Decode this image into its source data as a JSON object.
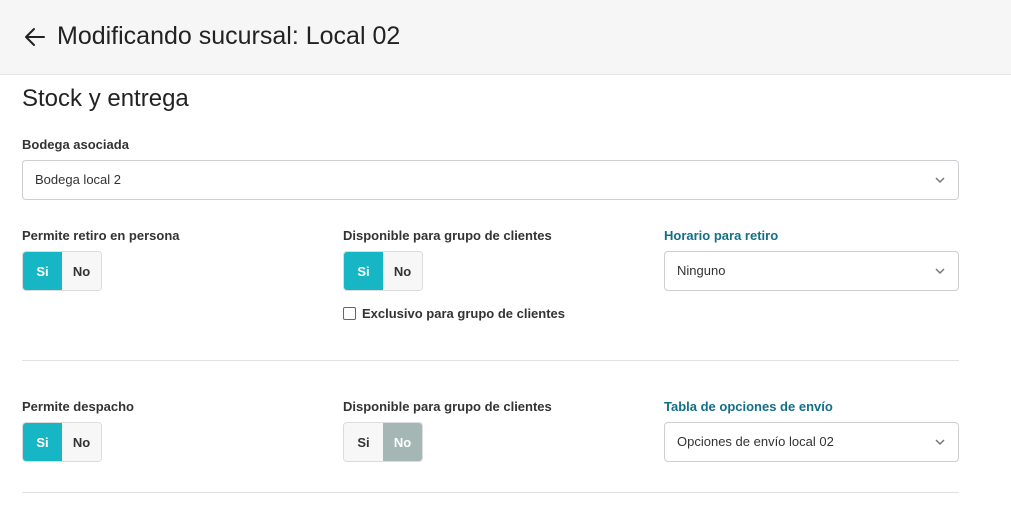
{
  "header": {
    "title": "Modificando sucursal: Local 02"
  },
  "section": {
    "title": "Stock y entrega"
  },
  "bodega": {
    "label": "Bodega asociada",
    "value": "Bodega local 2"
  },
  "retiro": {
    "label": "Permite retiro en persona",
    "yes": "Si",
    "no": "No",
    "selected": "Si",
    "grupo": {
      "label": "Disponible para grupo de clientes",
      "yes": "Si",
      "no": "No",
      "selected": "Si"
    },
    "exclusivo": {
      "label": "Exclusivo para grupo de clientes",
      "checked": false
    },
    "horario": {
      "label": "Horario para retiro",
      "value": "Ninguno"
    }
  },
  "despacho": {
    "label": "Permite despacho",
    "yes": "Si",
    "no": "No",
    "selected": "Si",
    "grupo": {
      "label": "Disponible para grupo de clientes",
      "yes": "Si",
      "no": "No",
      "selected": "No"
    },
    "tabla": {
      "label": "Tabla de opciones de envío",
      "value": "Opciones de envío local 02"
    }
  },
  "colors": {
    "accent": "#16b6c4",
    "link": "#136f86",
    "disabled_selected": "#a5b7b4"
  }
}
